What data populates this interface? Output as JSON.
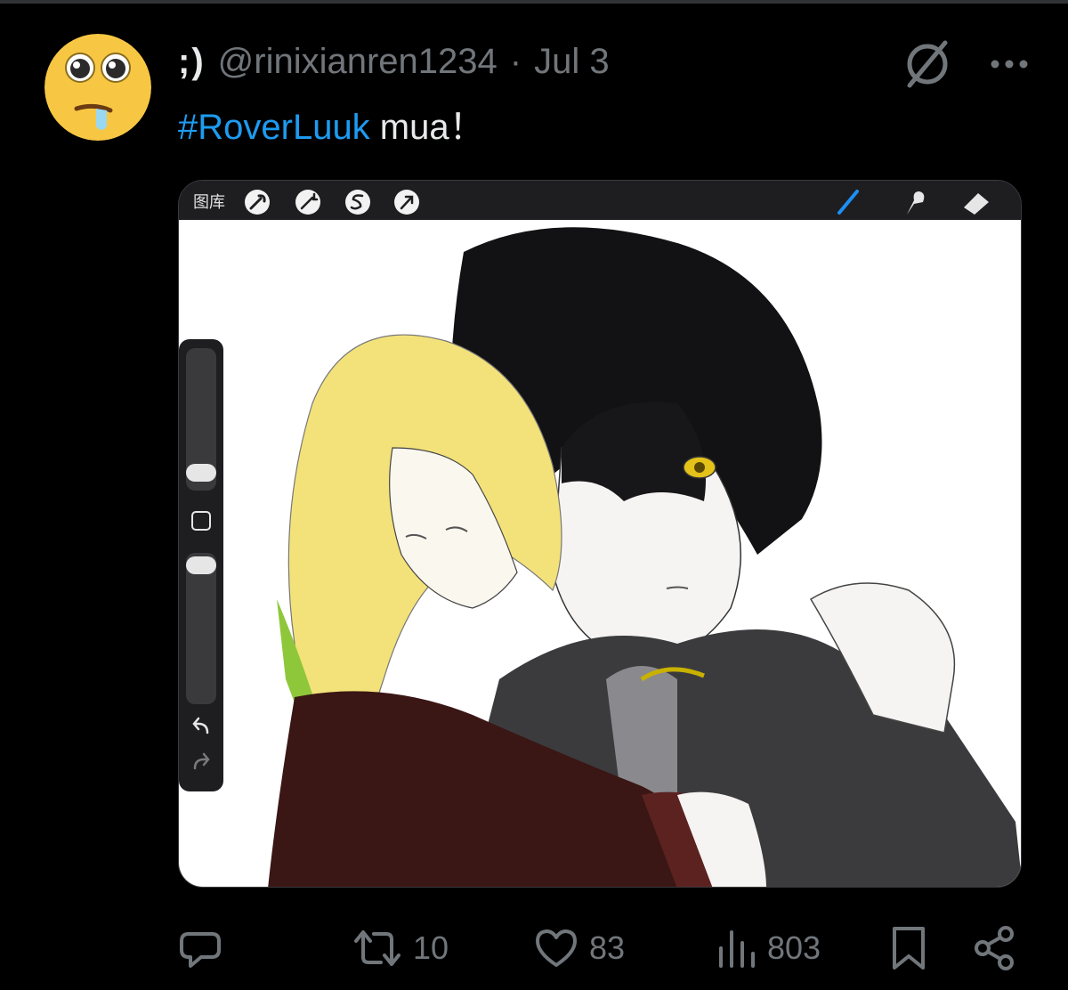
{
  "tweet": {
    "display_name": ";)",
    "handle": "@rinixianren1234",
    "separator": "·",
    "date": "Jul 3",
    "hashtag": "#RoverLuuk",
    "text": " mua！"
  },
  "media": {
    "app_toolbar": {
      "gallery_label": "图库",
      "left_tools": [
        "wrench-icon",
        "magic-wand-icon",
        "selection-icon",
        "transform-arrow-icon"
      ],
      "right_tools": [
        "brush-icon",
        "smudge-icon",
        "eraser-icon"
      ],
      "active_tool": "brush-icon"
    },
    "side_panel": [
      "brush-size-slider",
      "modify-button",
      "opacity-slider",
      "undo-button",
      "redo-button"
    ]
  },
  "actions": {
    "reply_count": "",
    "retweet_count": "10",
    "like_count": "83",
    "view_count": "803"
  },
  "colors": {
    "background": "#000000",
    "text_primary": "#e7e9ea",
    "text_secondary": "#71767b",
    "accent": "#1d9bf0"
  }
}
